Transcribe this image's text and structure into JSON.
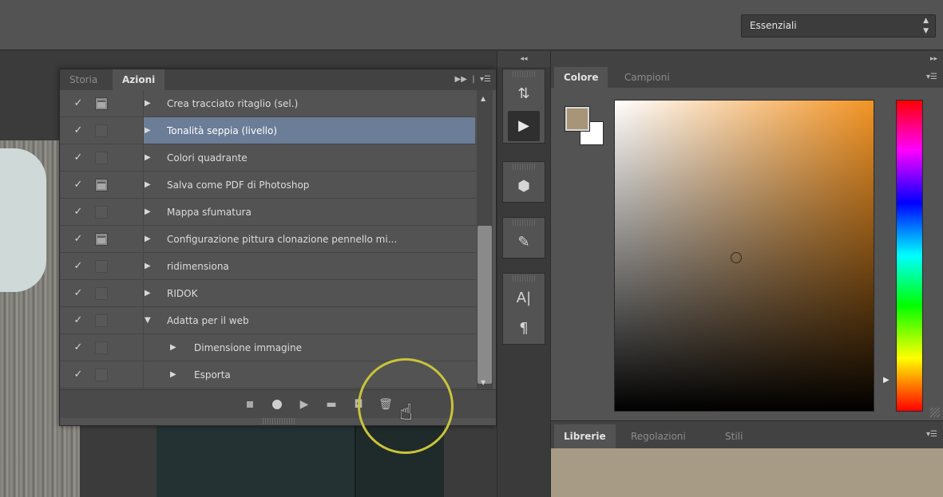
{
  "header": {
    "workspace": "Essenziali"
  },
  "actions_panel": {
    "tabs": [
      {
        "label": "Storia",
        "active": false
      },
      {
        "label": "Azioni",
        "active": true
      }
    ],
    "items": [
      {
        "label": "Crea tracciato ritaglio (sel.)",
        "checked": true,
        "dialog": true,
        "expanded": false,
        "indent": 0,
        "selected": false
      },
      {
        "label": "Tonalità seppia (livello)",
        "checked": true,
        "dialog": false,
        "expanded": false,
        "indent": 0,
        "selected": true
      },
      {
        "label": "Colori quadrante",
        "checked": true,
        "dialog": false,
        "expanded": false,
        "indent": 0,
        "selected": false
      },
      {
        "label": "Salva come PDF di Photoshop",
        "checked": true,
        "dialog": true,
        "expanded": false,
        "indent": 0,
        "selected": false
      },
      {
        "label": "Mappa sfumatura",
        "checked": true,
        "dialog": false,
        "expanded": false,
        "indent": 0,
        "selected": false
      },
      {
        "label": "Configurazione pittura clonazione pennello mi...",
        "checked": true,
        "dialog": true,
        "expanded": false,
        "indent": 0,
        "selected": false
      },
      {
        "label": "ridimensiona",
        "checked": true,
        "dialog": false,
        "expanded": false,
        "indent": 0,
        "selected": false
      },
      {
        "label": "RIDOK",
        "checked": true,
        "dialog": false,
        "expanded": false,
        "indent": 0,
        "selected": false
      },
      {
        "label": "Adatta per il web",
        "checked": true,
        "dialog": false,
        "expanded": true,
        "indent": 0,
        "selected": false
      },
      {
        "label": "Dimensione immagine",
        "checked": true,
        "dialog": false,
        "expanded": false,
        "indent": 1,
        "selected": false
      },
      {
        "label": "Esporta",
        "checked": true,
        "dialog": false,
        "expanded": false,
        "indent": 1,
        "selected": false
      }
    ],
    "footer_tools": [
      "stop-icon",
      "record-icon",
      "play-icon",
      "folder-icon",
      "new-action-icon",
      "trash-icon"
    ]
  },
  "color_panel": {
    "tabs": [
      {
        "label": "Colore",
        "active": true
      },
      {
        "label": "Campioni",
        "active": false
      }
    ],
    "foreground_color": "#a89578",
    "background_color": "#ffffff",
    "hue_color": "#f39424"
  },
  "libraries_panel": {
    "tabs": [
      {
        "label": "Librerie",
        "active": true
      },
      {
        "label": "Regolazioni",
        "active": false
      },
      {
        "label": "Stili",
        "active": false
      }
    ]
  },
  "strip_tools": [
    "history-icon",
    "play-icon",
    "cube-icon",
    "brush-icon",
    "text-icon",
    "paragraph-icon"
  ]
}
